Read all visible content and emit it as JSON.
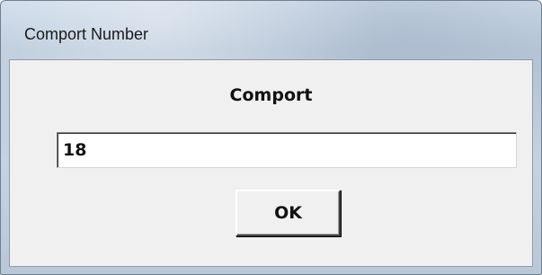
{
  "window": {
    "title": "Comport Number"
  },
  "dialog": {
    "heading": "Comport",
    "input_value": "18",
    "ok_label": "OK"
  },
  "colors": {
    "client_bg": "#f0f0f0",
    "titlebar_bg": "#c5d2e1"
  }
}
